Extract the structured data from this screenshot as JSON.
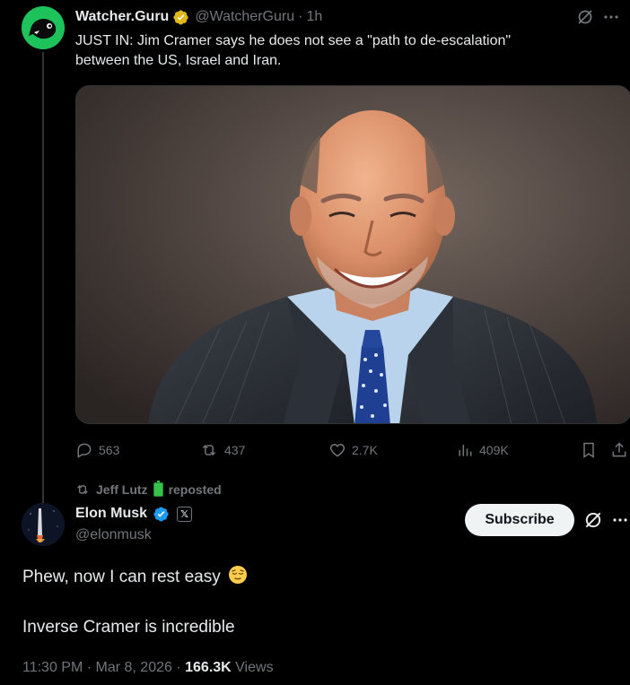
{
  "quoted_tweet": {
    "display_name": "Watcher.Guru",
    "handle": "@WatcherGuru",
    "separator": "·",
    "time_ago": "1h",
    "text_line1": "JUST IN: Jim Cramer says he does not see a \"path to de-escalation\"",
    "text_line2": "between the US, Israel and Iran.",
    "avatar_icon": "watcher-guru-logo",
    "accent_color": "#1ec25a",
    "stats": {
      "replies": "563",
      "reposts": "437",
      "likes": "2.7K",
      "views": "409K"
    }
  },
  "repost_banner": {
    "user": "Jeff Lutz",
    "action": "reposted",
    "badge_icon": "battery-emoji"
  },
  "main_tweet": {
    "display_name": "Elon Musk",
    "handle": "@elonmusk",
    "affiliation_badge": "𝕏",
    "subscribe_label": "Subscribe",
    "text_line1": "Phew, now I can rest easy",
    "text_line2": "Inverse Cramer is incredible",
    "emoji_icon": "relieved-face-emoji",
    "timestamp": "11:30 PM · Mar 8, 2026 ·",
    "views_count": "166.3K",
    "views_label": "Views",
    "verified_color": "#1d9bf0"
  },
  "colors": {
    "background": "#000000",
    "text": "#e7e9ea",
    "muted": "#71767b",
    "gold_verified": "#e2b719"
  }
}
